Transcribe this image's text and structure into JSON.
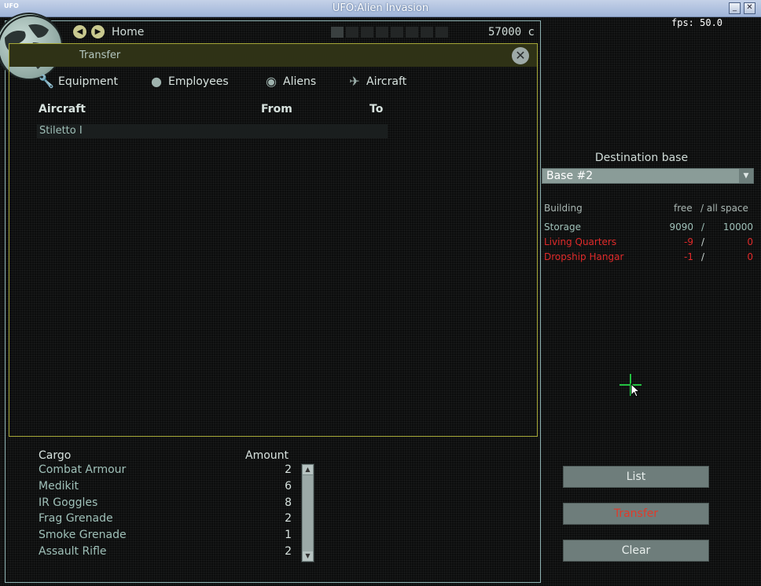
{
  "window": {
    "title": "UFO:Alien Invasion",
    "app_icon": "UFO",
    "minimize": "_",
    "close": "✕"
  },
  "hud": {
    "home_label": "Home",
    "credits": "57000 c",
    "fps": "fps: 50.0"
  },
  "transfer": {
    "title": "Transfer",
    "tabs": [
      {
        "label": "Equipment",
        "icon": "wrench-icon"
      },
      {
        "label": "Employees",
        "icon": "head-icon"
      },
      {
        "label": "Aliens",
        "icon": "alien-icon"
      },
      {
        "label": "Aircraft",
        "icon": "aircraft-icon"
      }
    ],
    "columns": {
      "item": "Aircraft",
      "from": "From",
      "to": "To"
    },
    "rows": [
      {
        "name": "Stiletto I"
      }
    ]
  },
  "cargo": {
    "header": "Cargo",
    "amount_header": "Amount",
    "items": [
      {
        "name": "Combat Armour",
        "amount": "2"
      },
      {
        "name": "Medikit",
        "amount": "6"
      },
      {
        "name": "IR Goggles",
        "amount": "8"
      },
      {
        "name": "Frag Grenade",
        "amount": "2"
      },
      {
        "name": "Smoke Grenade",
        "amount": "1"
      },
      {
        "name": "Assault Rifle",
        "amount": "2"
      }
    ]
  },
  "destination": {
    "label": "Destination base",
    "selected": "Base #2",
    "buildings_header": "Building",
    "free_header": "free",
    "all_header": "/ all space",
    "buildings": [
      {
        "name": "Storage",
        "free": "9090",
        "all": "10000",
        "status": "normal"
      },
      {
        "name": "Living Quarters",
        "free": "-9",
        "all": "0",
        "status": "alert"
      },
      {
        "name": "Dropship Hangar",
        "free": "-1",
        "all": "0",
        "status": "alert"
      }
    ]
  },
  "actions": {
    "list": "List",
    "transfer": "Transfer",
    "clear": "Clear"
  },
  "colors": {
    "accent_panel": "#a6a838",
    "alert": "#e02a2a",
    "text_primary": "#d7e2de",
    "text_secondary": "#9fc0b8"
  }
}
